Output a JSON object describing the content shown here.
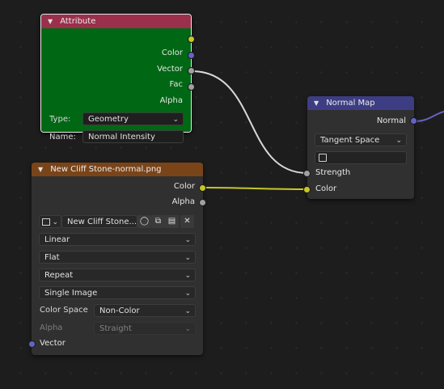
{
  "colors": {
    "background": "#1d1d1d",
    "attribute_header": "#9a304b",
    "attribute_body": "#006714",
    "normal_map_header": "#3d3d83",
    "image_header": "#7a4419",
    "socket_color": "#c7c729",
    "socket_vector": "#6363c7",
    "socket_float": "#a1a1a1"
  },
  "attribute_node": {
    "title": "Attribute",
    "outputs": [
      "Color",
      "Vector",
      "Fac",
      "Alpha"
    ],
    "type_label": "Type:",
    "type_value": "Geometry",
    "name_label": "Name:",
    "name_value": "Normal Intensity"
  },
  "normal_map_node": {
    "title": "Normal Map",
    "output": "Normal",
    "space_value": "Tangent Space",
    "inputs": [
      "Strength",
      "Color"
    ]
  },
  "image_node": {
    "title": "New Cliff Stone-normal.png",
    "outputs": [
      "Color",
      "Alpha"
    ],
    "image_name": "New Cliff Stone...",
    "interpolation": "Linear",
    "projection": "Flat",
    "extension": "Repeat",
    "source": "Single Image",
    "color_space_label": "Color Space",
    "color_space_value": "Non-Color",
    "alpha_label": "Alpha",
    "alpha_value": "Straight",
    "input": "Vector"
  }
}
